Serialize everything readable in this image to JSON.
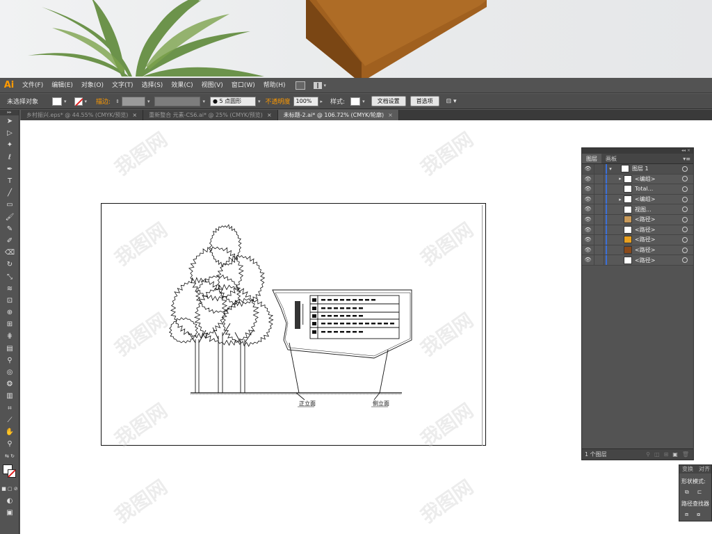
{
  "app": {
    "logo": "Ai"
  },
  "menu": [
    "文件(F)",
    "编辑(E)",
    "对象(O)",
    "文字(T)",
    "选择(S)",
    "效果(C)",
    "视图(V)",
    "窗口(W)",
    "帮助(H)"
  ],
  "control": {
    "selection_label": "未选择对象",
    "stroke_label": "描边:",
    "brush_value": "5 点圆形",
    "opacity_label": "不透明度",
    "opacity_value": "100%",
    "style_label": "样式:",
    "doc_setup_button": "文档设置",
    "prefs_button": "首选项"
  },
  "tabs": [
    {
      "label": "乡村振兴.eps* @ 44.55% (CMYK/预览)",
      "active": false
    },
    {
      "label": "重新整合 元素-CS6.ai* @ 25% (CMYK/预览)",
      "active": false
    },
    {
      "label": "未标题-2.ai* @ 106.72% (CMYK/轮廓)",
      "active": true
    }
  ],
  "layers_panel": {
    "tabs": [
      "图层",
      "画板"
    ],
    "rows": [
      {
        "name": "图层 1",
        "expand": true,
        "top": true
      },
      {
        "name": "<编组>",
        "expand": true
      },
      {
        "name": "Total...",
        "expand": false
      },
      {
        "name": "<编组>",
        "expand": true
      },
      {
        "name": "视图...",
        "expand": false
      },
      {
        "name": "<路径>",
        "expand": false,
        "thumb": "#c89a5a"
      },
      {
        "name": "<路径>",
        "expand": false,
        "thumb": "#ffffff"
      },
      {
        "name": "<路径>",
        "expand": false,
        "thumb": "#e8a020"
      },
      {
        "name": "<路径>",
        "expand": false,
        "thumb": "#8a4a1a"
      },
      {
        "name": "<路径>",
        "expand": false,
        "thumb": "#ffffff"
      }
    ],
    "count": "1 个图层"
  },
  "mini_panel": {
    "tabs": [
      "变换",
      "对齐"
    ],
    "shape_mode": "形状模式:",
    "pathfinder": "路径查找器"
  },
  "artwork": {
    "label_front": "正立面",
    "label_side": "侧立面"
  },
  "watermark": "我图网",
  "colors": {
    "accent": "#ff9a00",
    "layer_bar": "#3a6fd8"
  }
}
